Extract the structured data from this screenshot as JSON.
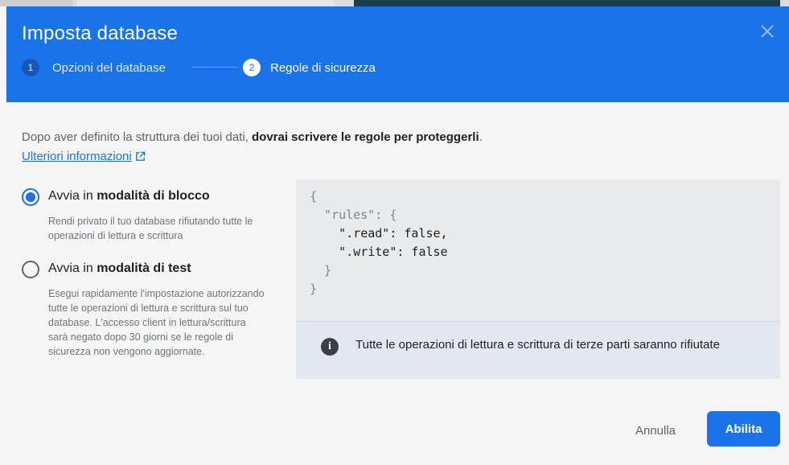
{
  "dialog": {
    "title": "Imposta database",
    "steps": [
      {
        "number": "1",
        "label": "Opzioni del database"
      },
      {
        "number": "2",
        "label": "Regole di sicurezza"
      }
    ]
  },
  "intro": {
    "text_plain": "Dopo aver definito la struttura dei tuoi dati, ",
    "text_bold": "dovrai scrivere le regole per proteggerli",
    "text_end": ".",
    "link_label": "Ulteriori informazioni"
  },
  "options": [
    {
      "prefix": "Avvia in ",
      "bold": "modalità di blocco",
      "description": "Rendi privato il tuo database rifiutando tutte le operazioni di lettura e scrittura",
      "selected": true
    },
    {
      "prefix": "Avvia in ",
      "bold": "modalità di test",
      "description": "Esegui rapidamente l'impostazione autorizzando tutte le operazioni di lettura e scrittura sul tuo database. L'accesso client in lettura/scrittura sarà negato dopo 30 giorni se le regole di sicurezza non vengono aggiornate.",
      "selected": false
    }
  ],
  "rules": {
    "line1": "{",
    "line2": "  \"rules\": {",
    "line3_key": "    \".read\"",
    "line3_val": ": false,",
    "line4_key": "    \".write\"",
    "line4_val": ": false",
    "line5": "  }",
    "line6": "}"
  },
  "info": {
    "text": "Tutte le operazioni di lettura e scrittura di terze parti saranno rifiutate",
    "icon_glyph": "i"
  },
  "actions": {
    "cancel_label": "Annulla",
    "enable_label": "Abilita"
  },
  "colors": {
    "header_blue": "#1a73e8",
    "panel_grey": "#e8eaed",
    "info_bg": "#e3e8f0"
  }
}
